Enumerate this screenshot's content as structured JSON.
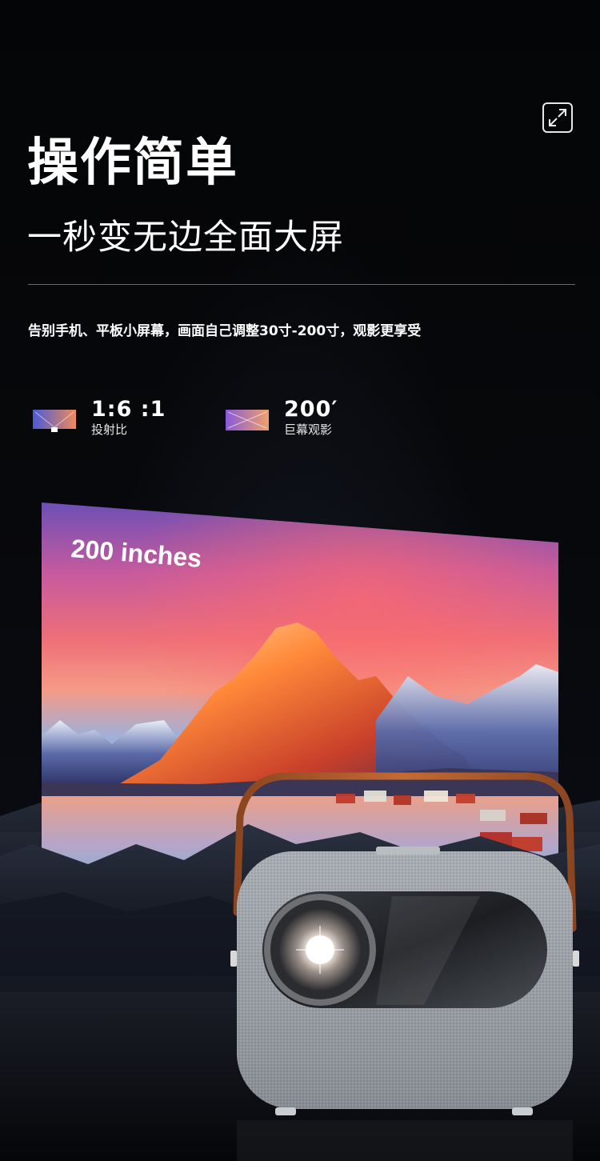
{
  "header": {
    "title": "操作简单",
    "subtitle": "一秒变无边全面大屏"
  },
  "description": "告别手机、平板小屏幕，画面自己调整30寸-200寸，观影更享受",
  "specs": [
    {
      "value": "1:6 :1",
      "label": "投射比",
      "icon": "throw-ratio-icon"
    },
    {
      "value": "200′",
      "label": "巨幕观影",
      "icon": "big-screen-icon"
    }
  ],
  "screen": {
    "caption": "200 inches"
  },
  "controls": {
    "expand_icon": "expand-arrows-icon"
  },
  "colors": {
    "background": "#050608",
    "text": "#ffffff",
    "divider": "#6a6a6a",
    "icon_gradient_start": "#4a5ad8",
    "icon_gradient_end": "#f07a5a",
    "strap": "#b35d2c",
    "projector_body": "#9aa0a6"
  }
}
